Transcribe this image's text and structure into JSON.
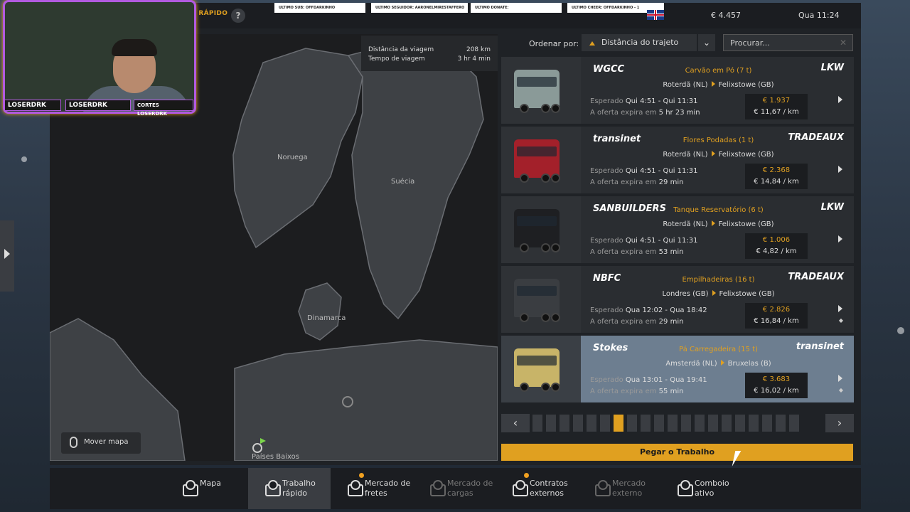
{
  "header": {
    "title_fragment": "O RÁPIDO",
    "help": "?",
    "money": "€ 4.457",
    "time": "Qua 11:24",
    "language_flag": "uk-flag-icon",
    "tickers": [
      "ULTIMO SUB: OFFDARKINHO",
      "ULTIMO SEGUIDOR: AARONELMIRESTAFFERO",
      "ULTIMO DONATE:",
      "ULTIMO CHEER: OFFDARKINHO - 1"
    ]
  },
  "stream": {
    "name_tag": "LOSERDRK",
    "insta": "LOSERDRK",
    "yt": "CORTES LOSERDRK"
  },
  "route_info": {
    "distance_label": "Distância da viagem",
    "distance_value": "208 km",
    "time_label": "Tempo de viagem",
    "time_value": "3 hr 4 min"
  },
  "map": {
    "labels": [
      "Noruega",
      "Suécia",
      "Dinamarca",
      "Países Baixos"
    ],
    "move_map": "Mover mapa"
  },
  "list_controls": {
    "sort_label": "Ordenar por:",
    "sort_value": "Distância do trajeto",
    "search_placeholder": "Procurar..."
  },
  "jobs": [
    {
      "company": "WGCC",
      "client": "LKW",
      "cargo": "Carvão em Pó (7 t)",
      "from": "Roterdã (NL)",
      "to": "Felixstowe (GB)",
      "expected_label": "Esperado",
      "expected": "Qui 4:51 - Qui 11:31",
      "offer_label": "A oferta expira em",
      "offer": "5 hr 23 min",
      "price": "€ 1.937",
      "per_km": "€ 11,67 / km",
      "truck_color": "#8a9a98",
      "selected": false,
      "gem": false
    },
    {
      "company": "transinet",
      "client": "TRADEAUX",
      "cargo": "Flores Podadas (1 t)",
      "from": "Roterdã (NL)",
      "to": "Felixstowe (GB)",
      "expected_label": "Esperado",
      "expected": "Qui 4:51 - Qui 11:31",
      "offer_label": "A oferta expira em",
      "offer": "29 min",
      "price": "€ 2.368",
      "per_km": "€ 14,84 / km",
      "truck_color": "#a3202a",
      "selected": false,
      "gem": false
    },
    {
      "company": "SANBUILDERS",
      "client": "LKW",
      "cargo": "Tanque Reservatório (6 t)",
      "from": "Roterdã (NL)",
      "to": "Felixstowe (GB)",
      "expected_label": "Esperado",
      "expected": "Qui 4:51 - Qui 11:31",
      "offer_label": "A oferta expira em",
      "offer": "53 min",
      "price": "€ 1.006",
      "per_km": "€ 4,82 / km",
      "truck_color": "#1e1f22",
      "selected": false,
      "gem": false
    },
    {
      "company": "NBFC",
      "client": "TRADEAUX",
      "cargo": "Empilhadeiras (16 t)",
      "from": "Londres (GB)",
      "to": "Felixstowe (GB)",
      "expected_label": "Esperado",
      "expected": "Qua 12:02 - Qua 18:42",
      "offer_label": "A oferta expira em",
      "offer": "29 min",
      "price": "€ 2.826",
      "per_km": "€ 16,84 / km",
      "truck_color": "#3a3d41",
      "selected": false,
      "gem": true
    },
    {
      "company": "Stokes",
      "client": "transinet",
      "cargo": "Pá Carregadeira (15 t)",
      "from": "Amsterdã (NL)",
      "to": "Bruxelas (B)",
      "expected_label": "Esperado",
      "expected": "Qua 13:01 - Qua 19:41",
      "offer_label": "A oferta expira em",
      "offer": "55 min",
      "price": "€ 3.683",
      "per_km": "€ 16,02 / km",
      "truck_color": "#c8b468",
      "selected": true,
      "gem": true
    }
  ],
  "pager": {
    "prev": "‹",
    "next": "›",
    "pages": 20,
    "current": 6
  },
  "take_job": "Pegar o Trabalho",
  "bottom_nav": [
    {
      "label": "Mapa",
      "icon": "map-icon",
      "active": false,
      "dim": false,
      "badge": false
    },
    {
      "label": "Trabalho rápido",
      "icon": "clock-box-icon",
      "active": true,
      "dim": false,
      "badge": false
    },
    {
      "label": "Mercado de fretes",
      "icon": "freight-market-icon",
      "active": false,
      "dim": false,
      "badge": true
    },
    {
      "label": "Mercado de cargas",
      "icon": "cargo-market-icon",
      "active": false,
      "dim": true,
      "badge": false
    },
    {
      "label": "Contratos externos",
      "icon": "globe-contracts-icon",
      "active": false,
      "dim": false,
      "badge": true
    },
    {
      "label": "Mercado externo",
      "icon": "external-market-icon",
      "active": false,
      "dim": true,
      "badge": false
    },
    {
      "label": "Comboio ativo",
      "icon": "convoy-icon",
      "active": false,
      "dim": false,
      "badge": false
    }
  ]
}
